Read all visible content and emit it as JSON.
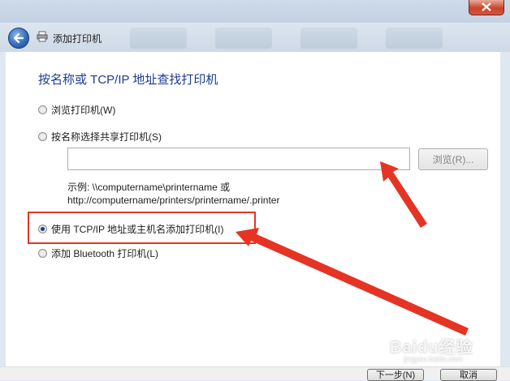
{
  "window": {
    "title": "添加打印机",
    "close_label": "关闭"
  },
  "page": {
    "heading": "按名称或 TCP/IP 地址查找打印机"
  },
  "options": [
    {
      "label": "浏览打印机(W)",
      "checked": false
    },
    {
      "label": "按名称选择共享打印机(S)",
      "checked": false
    },
    {
      "label": "使用 TCP/IP 地址或主机名添加打印机(I)",
      "checked": true
    },
    {
      "label": "添加 Bluetooth 打印机(L)",
      "checked": false
    }
  ],
  "share_input": {
    "value": "",
    "browse_label": "浏览(R)..."
  },
  "example": {
    "line1": "示例: \\\\computername\\printername 或",
    "line2": "http://computername/printers/printername/.printer"
  },
  "footer": {
    "next_label": "下一步(N)",
    "cancel_label": "取消"
  },
  "watermark": {
    "brand": "Baidu经验",
    "url": "jingyan.baidu.com"
  },
  "colors": {
    "heading": "#1a3c8f",
    "annotation": "#e53424"
  }
}
